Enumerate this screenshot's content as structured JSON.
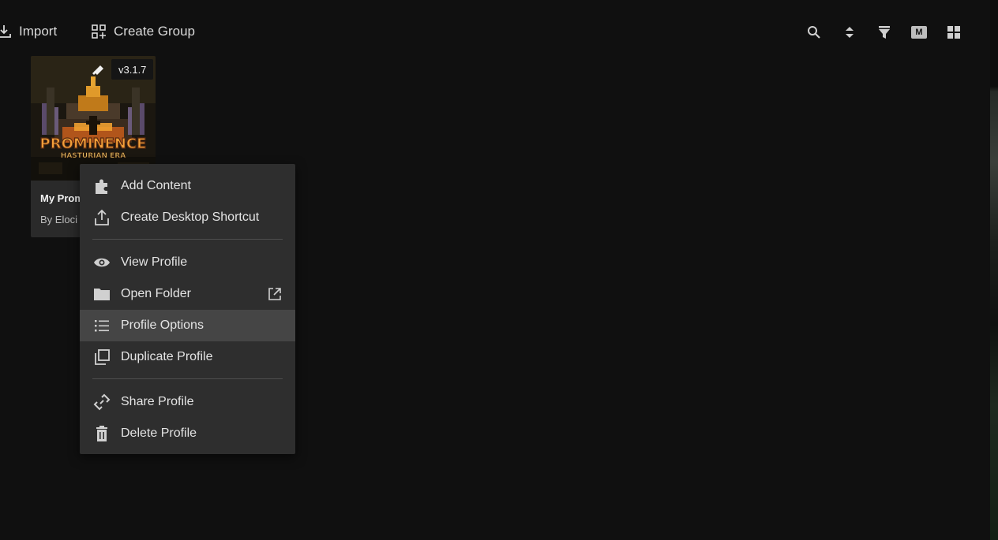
{
  "toolbar": {
    "import_label": "Import",
    "create_group_label": "Create Group",
    "actions": {
      "search": "search-icon",
      "sort": "sort-icon",
      "filter": "filter-icon",
      "m_badge": "M",
      "grid": "grid-view-icon"
    }
  },
  "profile_card": {
    "art_title": "PROMINENCE",
    "art_subtitle": "HASTURIAN ERA",
    "version": "v3.1.7",
    "title": "My Prom",
    "author": "By Eloci"
  },
  "context_menu": {
    "items": [
      {
        "label": "Add Content",
        "icon": "puzzle-icon"
      },
      {
        "label": "Create Desktop Shortcut",
        "icon": "share-upload-icon"
      },
      {
        "label": "View Profile",
        "icon": "eye-icon"
      },
      {
        "label": "Open Folder",
        "icon": "folder-icon",
        "trailing_icon": "external-link-icon"
      },
      {
        "label": "Profile Options",
        "icon": "list-icon",
        "hovered": true
      },
      {
        "label": "Duplicate Profile",
        "icon": "duplicate-icon"
      },
      {
        "label": "Share Profile",
        "icon": "link-icon"
      },
      {
        "label": "Delete Profile",
        "icon": "trash-icon"
      }
    ]
  },
  "colors": {
    "background": "#101010",
    "menu_bg": "#2e2e2e",
    "menu_hover": "#454545",
    "card_bg": "#2a2a2a",
    "text": "#e4e4e4",
    "accent_orange": "#e08a1e"
  }
}
